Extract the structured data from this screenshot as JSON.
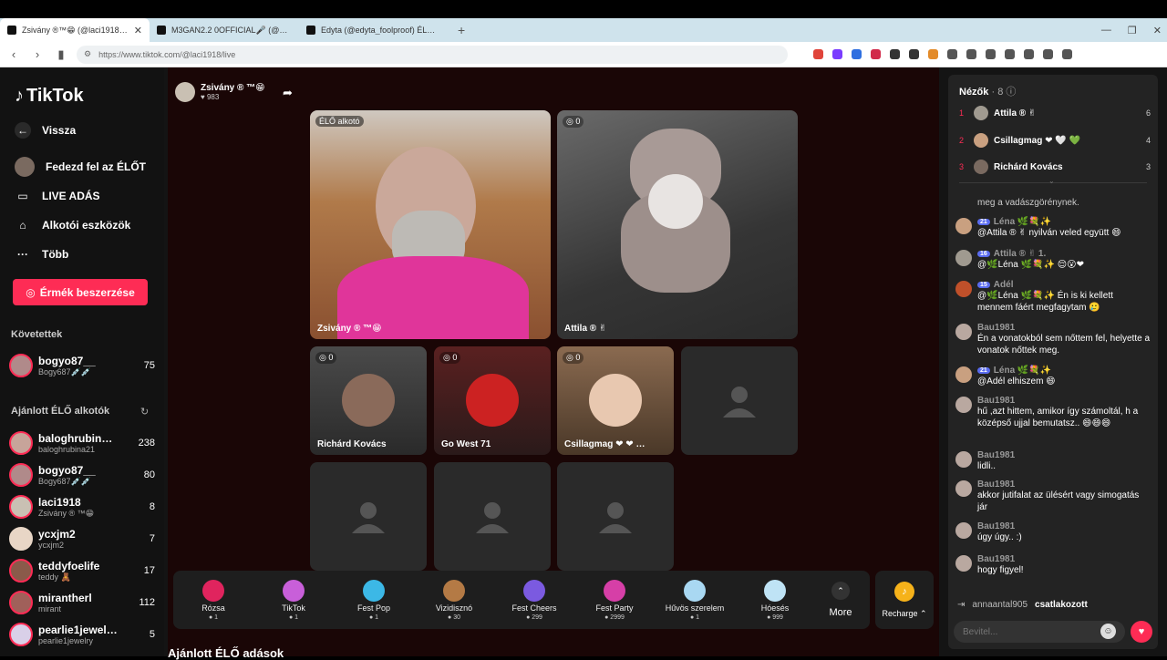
{
  "browser": {
    "tabs": [
      {
        "title": "Zsivány ®™😁 (@laci1918) É…",
        "active": true
      },
      {
        "title": "M3GAN2.2 0OFFICIAL🎤 (@m3g…",
        "active": false
      },
      {
        "title": "Edyta (@edyta_foolproof) ÉLŐ ad…",
        "active": false
      }
    ],
    "url": "https://www.tiktok.com/@laci1918/live"
  },
  "sidebar": {
    "brand": "TikTok",
    "back": "Vissza",
    "nav": [
      {
        "label": "Fedezd fel az ÉLŐT",
        "icon": "explore-avatar-icon"
      },
      {
        "label": "LIVE ADÁS",
        "icon": "live-camera-icon"
      },
      {
        "label": "Alkotói eszközök",
        "icon": "creator-tools-icon"
      },
      {
        "label": "Több",
        "icon": "more-dots-icon"
      }
    ],
    "coins_button": "Érmék beszerzése",
    "following_title": "Követettek",
    "following": [
      {
        "name": "bogyo87__",
        "handle": "Bogy687💉💉",
        "count": "75"
      }
    ],
    "recommended_title": "Ajánlott ÉLŐ alkotók",
    "recommended": [
      {
        "name": "baloghrubin…",
        "handle": "baloghrubina21",
        "count": "238"
      },
      {
        "name": "bogyo87__",
        "handle": "Bogy687💉💉",
        "count": "80"
      },
      {
        "name": "laci1918",
        "handle": "Zsivány ® ™😁",
        "count": "8"
      },
      {
        "name": "ycxjm2",
        "handle": "ycxjm2",
        "count": "7"
      },
      {
        "name": "teddyfoelife",
        "handle": "teddy 🧸",
        "count": "17"
      },
      {
        "name": "mirantherl",
        "handle": "mirant",
        "count": "112"
      },
      {
        "name": "pearlie1jewel…",
        "handle": "pearlie1jewelry",
        "count": "5"
      }
    ]
  },
  "host": {
    "name": "Zsivány ® ™😁",
    "likes": "♥ 983"
  },
  "stage": {
    "host_badge": "ÉLŐ alkotó",
    "host_name": "Zsivány ® ™😁",
    "guest_top": {
      "badge": "0",
      "name": "Attila ® ✌"
    },
    "guests": [
      {
        "badge": "0",
        "name": "Richárd Kovács"
      },
      {
        "badge": "0",
        "name": "Go West 71"
      },
      {
        "badge": "0",
        "name": "Csillagmag ❤ ❤ …"
      }
    ]
  },
  "gifts": [
    {
      "name": "Rózsa",
      "price": "1",
      "color": "#e0245e"
    },
    {
      "name": "TikTok",
      "price": "1",
      "color": "#c85fd9"
    },
    {
      "name": "Fest Pop",
      "price": "1",
      "color": "#3cb8e6"
    },
    {
      "name": "Vizidisznó",
      "price": "30",
      "color": "#b47a45"
    },
    {
      "name": "Fest Cheers",
      "price": "299",
      "color": "#7b5ae0"
    },
    {
      "name": "Fest Party",
      "price": "2999",
      "color": "#d63fa7"
    },
    {
      "name": "Hűvös szerelem",
      "price": "1",
      "color": "#a9d8f2"
    },
    {
      "name": "Hóesés",
      "price": "999",
      "color": "#bfe3f5"
    }
  ],
  "gift_more": "More",
  "recharge": "Recharge",
  "recommended_lives": "Ajánlott ÉLŐ adások",
  "chat": {
    "viewers_title": "Nézők",
    "viewers_count": "· 8",
    "top_viewers": [
      {
        "rank": "1",
        "name": "Attila ® ✌",
        "score": "6"
      },
      {
        "rank": "2",
        "name": "Csillagmag ❤ 🤍 💚",
        "score": "4"
      },
      {
        "rank": "3",
        "name": "Richárd Kovács",
        "score": "3"
      }
    ],
    "messages": [
      {
        "user": "",
        "level": "",
        "text": "meg a vadászgörénynek."
      },
      {
        "user": "Léna 🌿💐✨",
        "level": "21",
        "text": "@Attila ® ✌ nyilván veled együtt 😄"
      },
      {
        "user": "Attila ® ✌ 1.",
        "level": "16",
        "text": "@🌿Léna 🌿💐✨ 😌😮❤"
      },
      {
        "user": "Adél",
        "level": "15",
        "text": "@🌿Léna 🌿💐✨ Én is ki kellett mennem fáért megfagytam 🥲"
      },
      {
        "user": "Bau1981",
        "level": "",
        "text": "Én a vonatokból sem nőttem fel, helyette a vonatok nőttek meg."
      },
      {
        "user": "Léna 🌿💐✨",
        "level": "21",
        "text": "@Adél elhiszem 😄"
      },
      {
        "user": "Bau1981",
        "level": "",
        "text": "hű ,azt hittem, amikor így számoltál, h a középső ujjal bemutatsz.. 😄😄😄"
      },
      {
        "user": "Bau1981",
        "level": "",
        "text": "lidli.."
      },
      {
        "user": "Bau1981",
        "level": "",
        "text": "akkor jutifalat az ülésért vagy simogatás jár"
      },
      {
        "user": "Bau1981",
        "level": "",
        "text": "úgy úgy.. :)"
      },
      {
        "user": "Bau1981",
        "level": "",
        "text": "hogy figyel!"
      }
    ],
    "join_user": "annaantal905",
    "join_text": "csatlakozott",
    "input_placeholder": "Bevitel..."
  }
}
